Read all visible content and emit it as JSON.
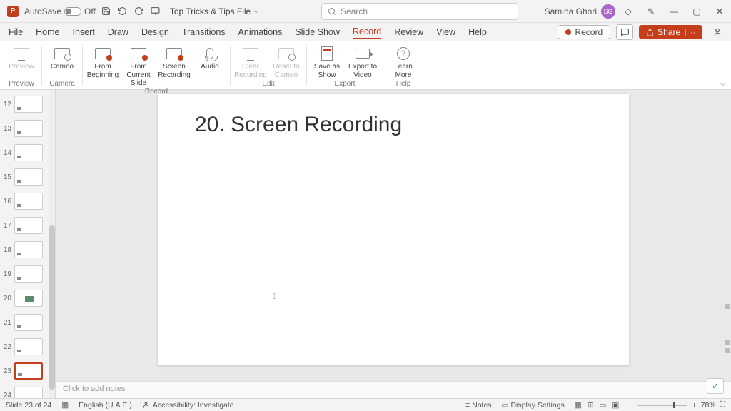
{
  "titlebar": {
    "autosave_label": "AutoSave",
    "autosave_state": "Off",
    "filename": "Top Tricks & Tips File",
    "search_placeholder": "Search",
    "username": "Samina Ghori",
    "user_initials": "SG"
  },
  "menu": {
    "tabs": [
      "File",
      "Home",
      "Insert",
      "Draw",
      "Design",
      "Transitions",
      "Animations",
      "Slide Show",
      "Record",
      "Review",
      "View",
      "Help"
    ],
    "active": "Record",
    "record_btn": "Record",
    "share_btn": "Share"
  },
  "ribbon": {
    "preview": "Preview",
    "cameo": "Cameo",
    "from_beginning": "From Beginning",
    "from_current": "From Current Slide",
    "screen_recording": "Screen Recording",
    "audio": "Audio",
    "clear_recording": "Clear Recording",
    "reset_cameo": "Reset to Cameo",
    "save_as_show": "Save as Show",
    "export_video": "Export to Video",
    "learn_more": "Learn More",
    "group_preview": "Preview",
    "group_camera": "Camera",
    "group_record": "Record",
    "group_edit": "Edit",
    "group_export": "Export",
    "group_help": "Help"
  },
  "thumbs": {
    "start": 12,
    "count": 13,
    "selected": 23,
    "with_image": 20
  },
  "slide": {
    "title": "20. Screen Recording"
  },
  "notes": {
    "placeholder": "Click to add notes"
  },
  "status": {
    "slide_info": "Slide 23 of 24",
    "language": "English (U.A.E.)",
    "accessibility": "Accessibility: Investigate",
    "notes": "Notes",
    "display": "Display Settings",
    "zoom": "78%"
  }
}
